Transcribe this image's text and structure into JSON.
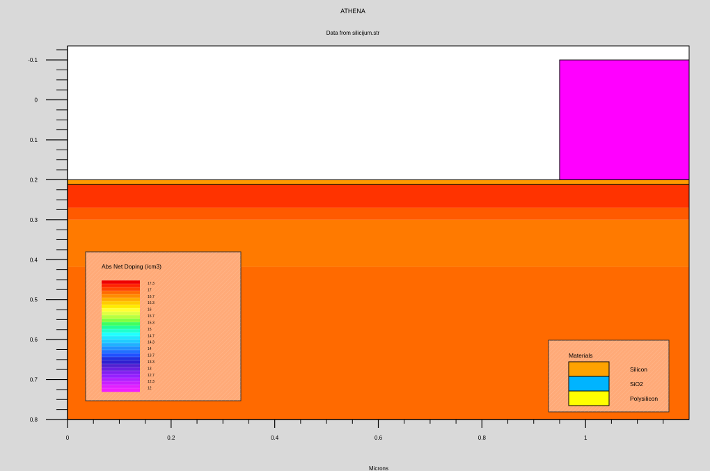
{
  "chart_data": {
    "type": "heatmap",
    "title": "ATHENA",
    "subtitle": "Data from silicijum.str",
    "xlabel": "Microns",
    "ylabel": "",
    "xlim": [
      0,
      1.2
    ],
    "ylim": [
      0.8,
      -0.135
    ],
    "x_ticks": [
      "0",
      "0.2",
      "0.4",
      "0.6",
      "0.8",
      "1"
    ],
    "x_tick_values": [
      0,
      0.2,
      0.4,
      0.6,
      0.8,
      1.0
    ],
    "y_ticks": [
      "-0.1",
      "0",
      "0.1",
      "0.2",
      "0.3",
      "0.4",
      "0.5",
      "0.6",
      "0.7",
      "0.8"
    ],
    "y_tick_values": [
      -0.1,
      0,
      0.1,
      0.2,
      0.3,
      0.4,
      0.5,
      0.6,
      0.7,
      0.8
    ],
    "regions": [
      {
        "material": "Polysilicon",
        "x": [
          0.95,
          1.2
        ],
        "y": [
          -0.1,
          0.2
        ],
        "color": "#ff00ff"
      },
      {
        "material": "SiO2",
        "x": [
          0,
          1.2
        ],
        "y": [
          0.2,
          0.212
        ],
        "color": "#ff9a00"
      },
      {
        "material": "Silicon",
        "x": [
          0,
          1.2
        ],
        "y": [
          0.212,
          0.8
        ],
        "color": "#ff6a00"
      }
    ],
    "doping_bands": [
      {
        "y": [
          0.2,
          0.212
        ],
        "log_doping": 16.0,
        "color": "#ff9a00"
      },
      {
        "y": [
          0.212,
          0.27
        ],
        "log_doping": 17.0,
        "color": "#ff3300"
      },
      {
        "y": [
          0.27,
          0.3
        ],
        "log_doping": 16.7,
        "color": "#ff5a00"
      },
      {
        "y": [
          0.3,
          0.418
        ],
        "log_doping": 16.3,
        "color": "#ff7a00"
      },
      {
        "y": [
          0.418,
          0.8
        ],
        "log_doping": 16.7,
        "color": "#ff6a00"
      }
    ],
    "doping_legend": {
      "title": "Abs Net Doping (/cm3)",
      "labels": [
        "17.3",
        "17",
        "16.7",
        "16.3",
        "16",
        "15.7",
        "15.3",
        "15",
        "14.7",
        "14.3",
        "14",
        "13.7",
        "13.3",
        "13",
        "12.7",
        "12.3",
        "12"
      ],
      "colors": [
        "#ee0000",
        "#ff2200",
        "#ff4500",
        "#ff6a00",
        "#ff8c00",
        "#ffac00",
        "#ffcc00",
        "#ffea00",
        "#ffff33",
        "#e0ff40",
        "#b8ff40",
        "#80ff40",
        "#40ff60",
        "#20ff99",
        "#20ffcc",
        "#20ffff",
        "#20e6ff",
        "#20ccff",
        "#20b0ff",
        "#2090ff",
        "#2070ff",
        "#2050ff",
        "#2030e0",
        "#3020d0",
        "#5020d0",
        "#6a20e0",
        "#8020f0",
        "#9620ff",
        "#b020ff",
        "#c820ff",
        "#e020ff",
        "#f020ff"
      ],
      "placement": "bottom-left"
    },
    "materials_legend": {
      "title": "Materials",
      "items": [
        {
          "label": "Silicon",
          "color": "#ffa200"
        },
        {
          "label": "SiO2",
          "color": "#00b4ff"
        },
        {
          "label": "Polysilicon",
          "color": "#ffff00"
        }
      ],
      "placement": "bottom-right"
    },
    "grid": false
  },
  "colors": {
    "page_background": "#d9d9d9",
    "plot_background": "#ffffff",
    "legend_fill": "#ffaa78"
  }
}
